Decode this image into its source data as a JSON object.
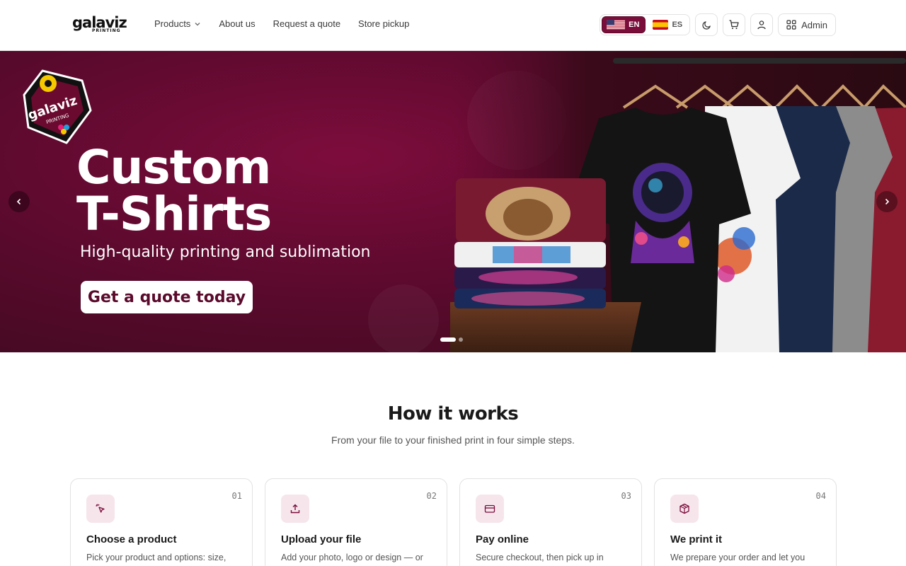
{
  "brand": {
    "name": "galaviz",
    "sub": "PRINTING",
    "badge_name": "galaviz",
    "badge_sub": "PRINTING"
  },
  "nav": {
    "items": [
      {
        "label": "Products",
        "icon": "chevron-down-icon"
      },
      {
        "label": "About us"
      },
      {
        "label": "Request a quote"
      },
      {
        "label": "Store pickup"
      }
    ]
  },
  "header_actions": {
    "lang_en": "EN",
    "lang_es": "ES",
    "theme_icon": "moon-icon",
    "cart_icon": "cart-icon",
    "user_icon": "user-icon",
    "admin_label": "Admin",
    "admin_icon": "grid-icon"
  },
  "hero": {
    "title_line1": "Custom",
    "title_line2": "T-Shirts",
    "subtitle": "High-quality printing and sublimation",
    "cta": "Get a quote today",
    "slide_index": 1,
    "slide_count": 2
  },
  "how_it_works": {
    "title": "How it works",
    "subtitle": "From your file to your finished print in four simple steps.",
    "steps": [
      {
        "num": "01",
        "title": "Choose a product",
        "desc": "Pick your product and options: size,",
        "icon": "pointer-click-icon"
      },
      {
        "num": "02",
        "title": "Upload your file",
        "desc": "Add your photo, logo or design — or",
        "icon": "upload-icon"
      },
      {
        "num": "03",
        "title": "Pay online",
        "desc": "Secure checkout, then pick up in",
        "icon": "credit-card-icon"
      },
      {
        "num": "04",
        "title": "We print it",
        "desc": "We prepare your order and let you",
        "icon": "package-icon"
      }
    ]
  },
  "colors": {
    "brand": "#7b0d3a",
    "hero_bg": "#5d0a2e",
    "accent_bg": "#f6e6ec"
  }
}
